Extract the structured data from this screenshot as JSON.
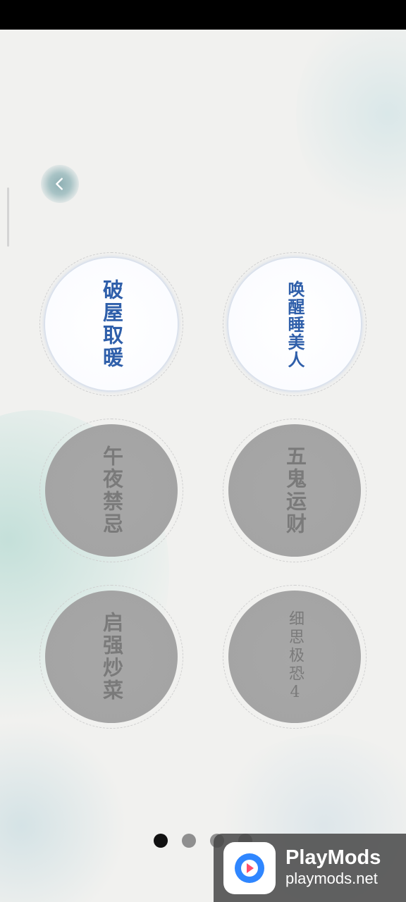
{
  "levels": [
    {
      "title": "破屋取暖",
      "state": "unlocked"
    },
    {
      "title": "唤醒睡美人",
      "state": "unlocked"
    },
    {
      "title": "午夜禁忌",
      "state": "locked"
    },
    {
      "title": "五鬼运财",
      "state": "locked"
    },
    {
      "title": "启强炒菜",
      "state": "locked"
    },
    {
      "title": "细思极恐4",
      "state": "locked"
    }
  ],
  "navigation": {
    "back_icon": "chevron-left-icon"
  },
  "pagination": {
    "current_page": 1,
    "visible_dots": 4
  },
  "watermark": {
    "name": "PlayMods",
    "url": "playmods.net",
    "logo_icon": "playmods-logo-icon"
  },
  "colors": {
    "unlocked_text": "#2f5faa",
    "locked_text": "#7a7a7a",
    "locked_fill": "#a5a5a5",
    "background": "#f1f1ef"
  }
}
